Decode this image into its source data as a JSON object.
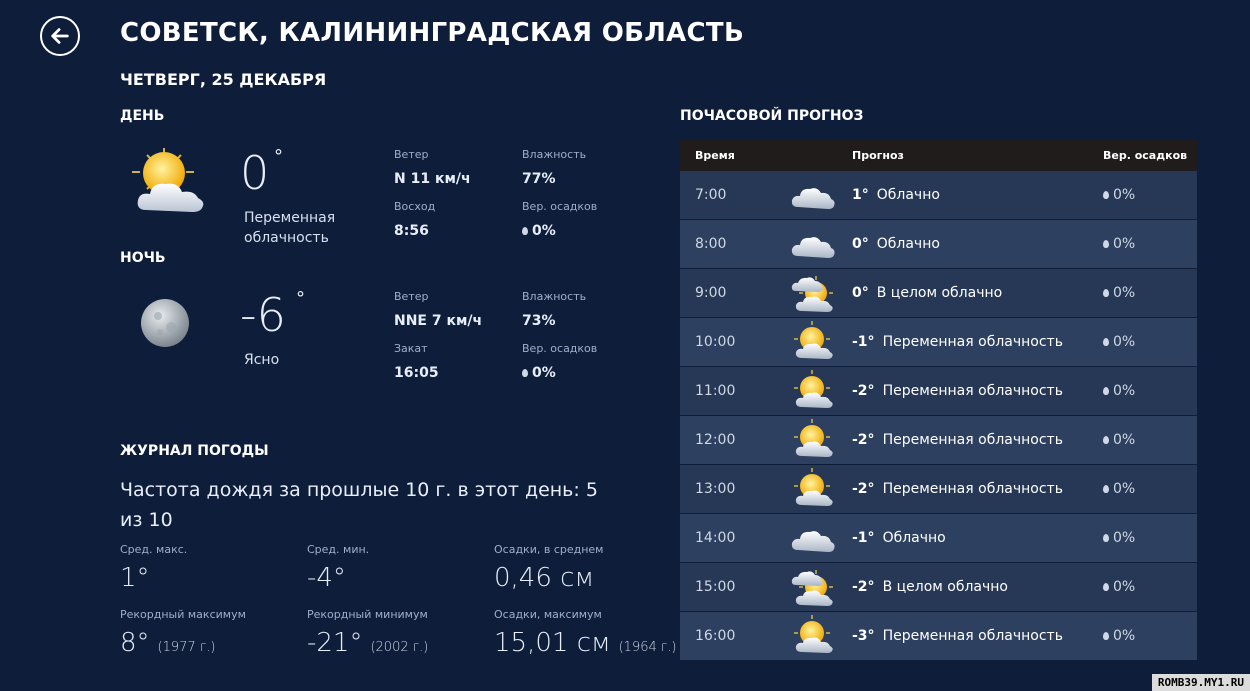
{
  "header": {
    "title": "СОВЕТСК, КАЛИНИНГРАДСКАЯ ОБЛАСТЬ",
    "date": "ЧЕТВЕРГ, 25 ДЕКАБРЯ"
  },
  "day": {
    "heading": "ДЕНЬ",
    "temp": "0",
    "deg": "°",
    "condition": "Переменная облачность",
    "wind_label": "Ветер",
    "wind": "N 11 км/ч",
    "humidity_label": "Влажность",
    "humidity": "77%",
    "sun_label": "Восход",
    "sun": "8:56",
    "precip_label": "Вер. осадков",
    "precip": "0%"
  },
  "night": {
    "heading": "НОЧЬ",
    "temp": "-6",
    "deg": "°",
    "condition": "Ясно",
    "wind_label": "Ветер",
    "wind": "NNE 7 км/ч",
    "humidity_label": "Влажность",
    "humidity": "73%",
    "sun_label": "Закат",
    "sun": "16:05",
    "precip_label": "Вер. осадков",
    "precip": "0%"
  },
  "journal": {
    "heading": "ЖУРНАЛ ПОГОДЫ",
    "subtitle": "Частота дождя за прошлые 10 г. в этот день: 5 из 10",
    "avg_max_label": "Сред. макс.",
    "avg_max": "1°",
    "avg_min_label": "Сред. мин.",
    "avg_min": "-4°",
    "precip_avg_label": "Осадки, в среднем",
    "precip_avg": "0,46 см",
    "record_max_label": "Рекордный максимум",
    "record_max": "8°",
    "record_max_year": "(1977 г.)",
    "record_min_label": "Рекордный минимум",
    "record_min": "-21°",
    "record_min_year": "(2002 г.)",
    "precip_max_label": "Осадки, максимум",
    "precip_max": "15,01 см",
    "precip_max_year": "(1964 г.)"
  },
  "hourly": {
    "heading": "ПОЧАСОВОЙ ПРОГНОЗ",
    "col_time": "Время",
    "col_forecast": "Прогноз",
    "col_precip": "Вер. осадков",
    "rows": [
      {
        "time": "7:00",
        "icon": "cloud-icon",
        "temp": "1°",
        "cond": "Облачно",
        "precip": "0%"
      },
      {
        "time": "8:00",
        "icon": "cloud-icon",
        "temp": "0°",
        "cond": "Облачно",
        "precip": "0%"
      },
      {
        "time": "9:00",
        "icon": "mostly-cloudy-icon",
        "temp": "0°",
        "cond": "В целом облачно",
        "precip": "0%"
      },
      {
        "time": "10:00",
        "icon": "partly-cloudy-icon",
        "temp": "-1°",
        "cond": "Переменная облачность",
        "precip": "0%"
      },
      {
        "time": "11:00",
        "icon": "partly-cloudy-icon",
        "temp": "-2°",
        "cond": "Переменная облачность",
        "precip": "0%"
      },
      {
        "time": "12:00",
        "icon": "partly-cloudy-icon",
        "temp": "-2°",
        "cond": "Переменная облачность",
        "precip": "0%"
      },
      {
        "time": "13:00",
        "icon": "partly-cloudy-icon",
        "temp": "-2°",
        "cond": "Переменная облачность",
        "precip": "0%"
      },
      {
        "time": "14:00",
        "icon": "cloud-icon",
        "temp": "-1°",
        "cond": "Облачно",
        "precip": "0%"
      },
      {
        "time": "15:00",
        "icon": "mostly-cloudy-icon",
        "temp": "-2°",
        "cond": "В целом облачно",
        "precip": "0%"
      },
      {
        "time": "16:00",
        "icon": "partly-cloudy-icon",
        "temp": "-3°",
        "cond": "Переменная облачность",
        "precip": "0%"
      }
    ]
  },
  "watermark": "ROMB39.MY1.RU",
  "colors": {
    "background": "#0e1d3a",
    "row_a": "#263856",
    "row_b": "#2e4060",
    "table_header": "#201c1c"
  }
}
